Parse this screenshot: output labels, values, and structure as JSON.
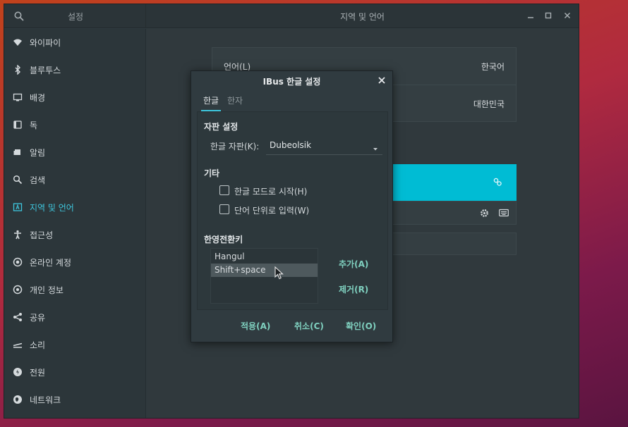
{
  "window": {
    "sidebar_title": "설정",
    "title": "지역 및 언어"
  },
  "sidebar": {
    "items": [
      {
        "label": "와이파이",
        "icon": "wifi-icon"
      },
      {
        "label": "블루투스",
        "icon": "bluetooth-icon"
      },
      {
        "label": "배경",
        "icon": "background-icon"
      },
      {
        "label": "독",
        "icon": "dock-icon"
      },
      {
        "label": "알림",
        "icon": "notification-icon"
      },
      {
        "label": "검색",
        "icon": "search-icon"
      },
      {
        "label": "지역 및 언어",
        "icon": "region-language-icon",
        "active": true
      },
      {
        "label": "접근성",
        "icon": "accessibility-icon"
      },
      {
        "label": "온라인 계정",
        "icon": "online-accounts-icon"
      },
      {
        "label": "개인 정보",
        "icon": "privacy-icon"
      },
      {
        "label": "공유",
        "icon": "share-icon"
      },
      {
        "label": "소리",
        "icon": "sound-icon"
      },
      {
        "label": "전원",
        "icon": "power-icon"
      },
      {
        "label": "네트워크",
        "icon": "network-icon"
      }
    ]
  },
  "main": {
    "language_label": "언어(L)",
    "language_value": "한국어",
    "formats_value": "대한민국"
  },
  "dialog": {
    "title": "IBus 한글 설정",
    "tabs": [
      "한글",
      "한자"
    ],
    "keyboard_section": "자판 설정",
    "keyboard_label": "한글 자판(K):",
    "keyboard_value": "Dubeolsik",
    "etc_section": "기타",
    "option_start_hangul": "한글 모드로 시작(H)",
    "option_word_commit": "단어 단위로 입력(W)",
    "toggle_section": "한영전환키",
    "toggle_keys": [
      "Hangul",
      "Shift+space"
    ],
    "selected_key_index": 1,
    "add_button": "추가(A)",
    "remove_button": "제거(R)",
    "apply_button": "적용(A)",
    "cancel_button": "취소(C)",
    "ok_button": "확인(O)"
  },
  "colors": {
    "accent": "#00bcd4",
    "active_text": "#3ec6dd",
    "link_button": "#7fd0bf"
  }
}
